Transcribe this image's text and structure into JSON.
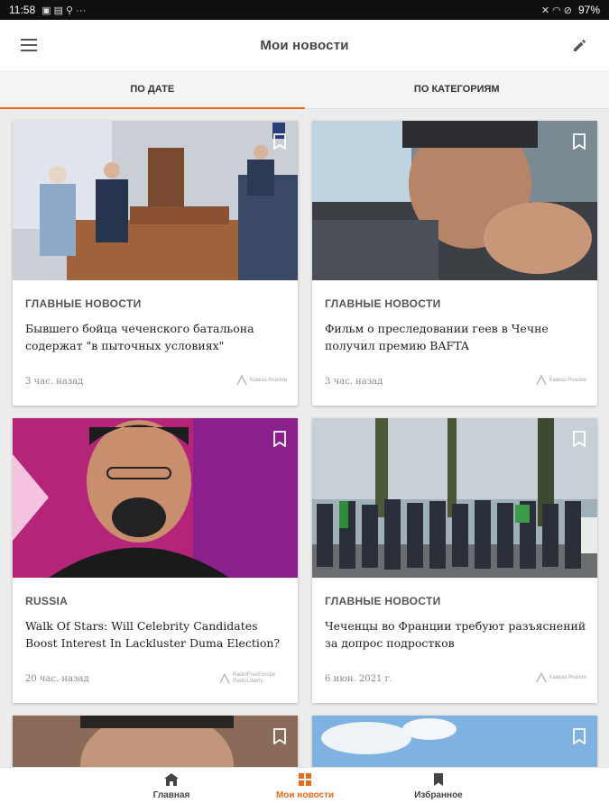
{
  "status": {
    "time": "11:58",
    "battery": "97%"
  },
  "appbar": {
    "title": "Мои новости"
  },
  "tabs": [
    {
      "label": "ПО ДАТЕ",
      "active": true
    },
    {
      "label": "ПО КАТЕГОРИЯМ",
      "active": false
    }
  ],
  "cards": [
    {
      "category": "ГЛАВНЫЕ НОВОСТИ",
      "headline": "Бывшего бойца чеченского батальона содержат \"в пыточных условиях\"",
      "time": "3 час. назад",
      "source": "Кавказ.Реалии"
    },
    {
      "category": "ГЛАВНЫЕ НОВОСТИ",
      "headline": "Фильм о преследовании геев в Чечне получил премию BAFTA",
      "time": "3 час. назад",
      "source": "Кавказ.Реалии"
    },
    {
      "category": "RUSSIA",
      "headline": "Walk Of Stars: Will Celebrity Candidates Boost Interest In Lackluster Duma Election?",
      "time": "20 час. назад",
      "source": "RadioFreeEurope RadioLiberty"
    },
    {
      "category": "ГЛАВНЫЕ НОВОСТИ",
      "headline": "Чеченцы во Франции требуют разъяснений за допрос подростков",
      "time": "6 июн. 2021 г.",
      "source": "Кавказ.Реалии"
    }
  ],
  "bottom_nav": [
    {
      "label": "Главная",
      "icon": "home-icon",
      "active": false
    },
    {
      "label": "Мои новости",
      "icon": "grid-icon",
      "active": true
    },
    {
      "label": "Избранное",
      "icon": "bookmark-icon",
      "active": false
    }
  ],
  "colors": {
    "accent": "#e86b1c",
    "background": "#ececec"
  }
}
